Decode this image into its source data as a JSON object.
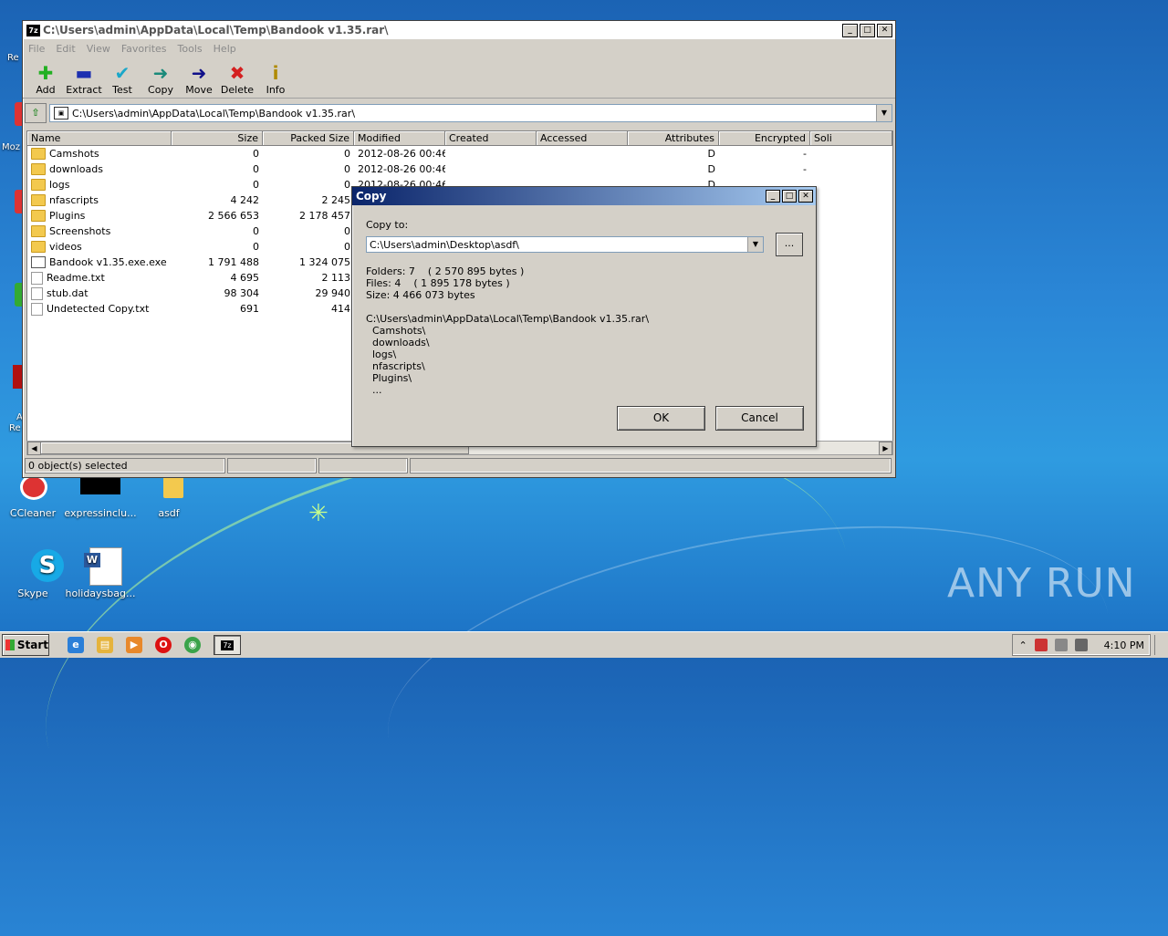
{
  "window": {
    "title": "C:\\Users\\admin\\AppData\\Local\\Temp\\Bandook v1.35.rar\\",
    "app_icon": "7z",
    "menu": [
      "File",
      "Edit",
      "View",
      "Favorites",
      "Tools",
      "Help"
    ],
    "toolbar": [
      {
        "label": "Add",
        "icon": "plus-icon",
        "glyph": "✚",
        "color": "#22b022"
      },
      {
        "label": "Extract",
        "icon": "minus-icon",
        "glyph": "▬",
        "color": "#1c2fb0"
      },
      {
        "label": "Test",
        "icon": "check-icon",
        "glyph": "✔",
        "color": "#1aa7c9"
      },
      {
        "label": "Copy",
        "icon": "copy-arrow-icon",
        "glyph": "➜",
        "color": "#1a8a7a"
      },
      {
        "label": "Move",
        "icon": "move-arrow-icon",
        "glyph": "➜",
        "color": "#10108a"
      },
      {
        "label": "Delete",
        "icon": "delete-x-icon",
        "glyph": "✖",
        "color": "#d42020"
      },
      {
        "label": "Info",
        "icon": "info-icon",
        "glyph": "i",
        "color": "#b08a00"
      }
    ],
    "address": "C:\\Users\\admin\\AppData\\Local\\Temp\\Bandook v1.35.rar\\",
    "columns": [
      "Name",
      "Size",
      "Packed Size",
      "Modified",
      "Created",
      "Accessed",
      "Attributes",
      "Encrypted",
      "Soli"
    ],
    "files": [
      {
        "type": "folder",
        "name": "Camshots",
        "size": "0",
        "packed": "0",
        "modified": "2012-08-26 00:46",
        "attributes": "D",
        "encrypted": "-"
      },
      {
        "type": "folder",
        "name": "downloads",
        "size": "0",
        "packed": "0",
        "modified": "2012-08-26 00:46",
        "attributes": "D",
        "encrypted": "-"
      },
      {
        "type": "folder",
        "name": "logs",
        "size": "0",
        "packed": "0",
        "modified": "2012-08-26 00:46",
        "attributes": "D",
        "encrypted": ""
      },
      {
        "type": "folder",
        "name": "nfascripts",
        "size": "4 242",
        "packed": "2 245",
        "modified": "",
        "attributes": "",
        "encrypted": ""
      },
      {
        "type": "folder",
        "name": "Plugins",
        "size": "2 566 653",
        "packed": "2 178 457",
        "modified": "",
        "attributes": "",
        "encrypted": ""
      },
      {
        "type": "folder",
        "name": "Screenshots",
        "size": "0",
        "packed": "0",
        "modified": "",
        "attributes": "",
        "encrypted": ""
      },
      {
        "type": "folder",
        "name": "videos",
        "size": "0",
        "packed": "0",
        "modified": "",
        "attributes": "",
        "encrypted": ""
      },
      {
        "type": "exe",
        "name": "Bandook v1.35.exe.exe",
        "size": "1 791 488",
        "packed": "1 324 075",
        "modified": "",
        "attributes": "",
        "encrypted": ""
      },
      {
        "type": "txt",
        "name": "Readme.txt",
        "size": "4 695",
        "packed": "2 113",
        "modified": "",
        "attributes": "",
        "encrypted": ""
      },
      {
        "type": "txt",
        "name": "stub.dat",
        "size": "98 304",
        "packed": "29 940",
        "modified": "",
        "attributes": "",
        "encrypted": ""
      },
      {
        "type": "txt",
        "name": "Undetected Copy.txt",
        "size": "691",
        "packed": "414",
        "modified": "",
        "attributes": "",
        "encrypted": ""
      }
    ],
    "status": "0 object(s) selected"
  },
  "dialog": {
    "title": "Copy",
    "copy_to_label": "Copy to:",
    "destination": "C:\\Users\\admin\\Desktop\\asdf\\",
    "browse_label": "...",
    "stats": "Folders: 7    ( 2 570 895 bytes )\nFiles: 4    ( 1 895 178 bytes )\nSize: 4 466 073 bytes",
    "listing": "C:\\Users\\admin\\AppData\\Local\\Temp\\Bandook v1.35.rar\\\n  Camshots\\\n  downloads\\\n  logs\\\n  nfascripts\\\n  Plugins\\\n  ...",
    "ok_label": "OK",
    "cancel_label": "Cancel"
  },
  "desktop": {
    "icons": [
      {
        "label": "CCleaner",
        "icon": "ccleaner-icon"
      },
      {
        "label": "expressinclu...",
        "icon": "black-app-icon"
      },
      {
        "label": "asdf",
        "icon": "folder-icon"
      },
      {
        "label": "Skype",
        "icon": "skype-icon"
      },
      {
        "label": "holidaysbag...",
        "icon": "word-doc-icon"
      }
    ],
    "edge_labels": [
      "Re",
      "Moz",
      "A",
      "Re"
    ],
    "watermark": "ANY RUN"
  },
  "taskbar": {
    "start_label": "Start",
    "clock": "4:10 PM"
  }
}
